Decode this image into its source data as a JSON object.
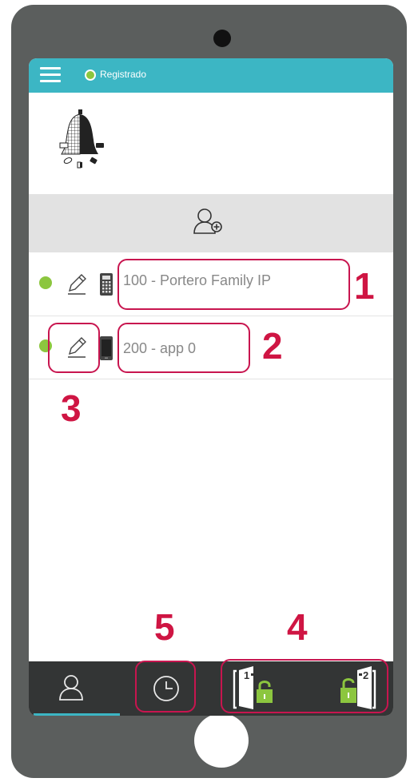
{
  "status": {
    "label": "Registrado",
    "dot_color": "#8cc63f"
  },
  "theme": {
    "accent": "#3cb6c4",
    "callout": "#cf1543",
    "online": "#8cc63f"
  },
  "contacts": [
    {
      "name": "100 - Portero Family IP",
      "device": "intercom-icon",
      "online": true
    },
    {
      "name": "200 - app 0",
      "device": "smartphone-icon",
      "online": true
    }
  ],
  "annotations": [
    "1",
    "2",
    "3",
    "4",
    "5"
  ],
  "bottom_nav": {
    "tabs": [
      "contacts-icon",
      "history-icon",
      "door-1-unlock-icon",
      "door-2-unlock-icon"
    ],
    "door1_label": "1",
    "door2_label": "2"
  }
}
